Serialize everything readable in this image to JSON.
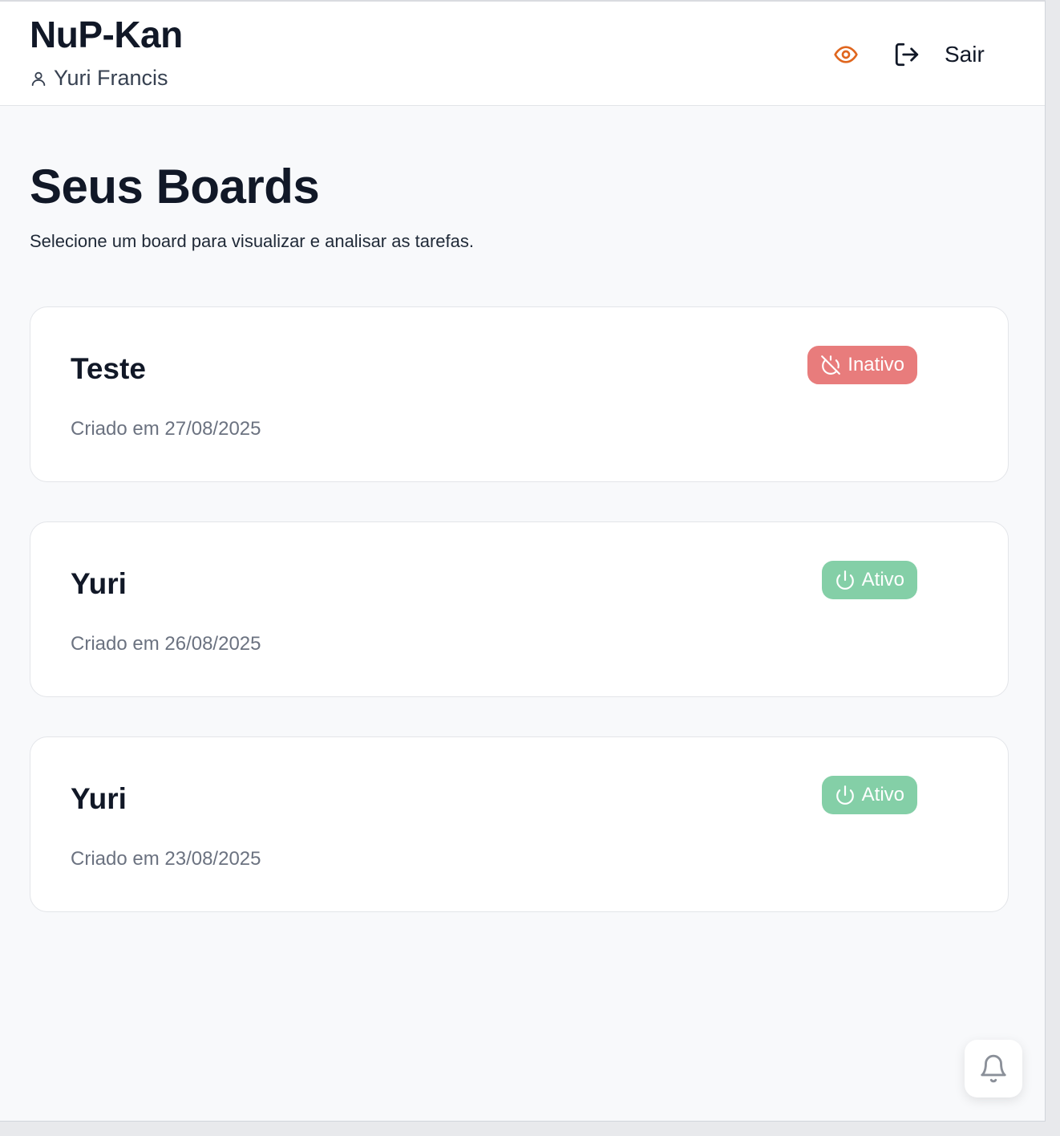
{
  "header": {
    "app_title": "NuP-Kan",
    "user_name": "Yuri Francis",
    "logout_label": "Sair"
  },
  "main": {
    "title": "Seus Boards",
    "subtitle": "Selecione um board para visualizar e analisar as tarefas."
  },
  "boards": [
    {
      "name": "Teste",
      "created": "Criado em 27/08/2025",
      "status": "Inativo",
      "status_color": "#e87c7c"
    },
    {
      "name": "Yuri",
      "created": "Criado em 26/08/2025",
      "status": "Ativo",
      "status_color": "#84cfa7"
    },
    {
      "name": "Yuri",
      "created": "Criado em 23/08/2025",
      "status": "Ativo",
      "status_color": "#84cfa7"
    }
  ],
  "colors": {
    "accent_eye": "#e0661e",
    "inactive": "#e87c7c",
    "active": "#84cfa7"
  },
  "icons": {
    "user": "user-icon",
    "eye": "eye-icon",
    "logout": "logout-icon",
    "inactive": "power-off-icon",
    "active": "power-icon",
    "notifications": "bell-icon"
  }
}
